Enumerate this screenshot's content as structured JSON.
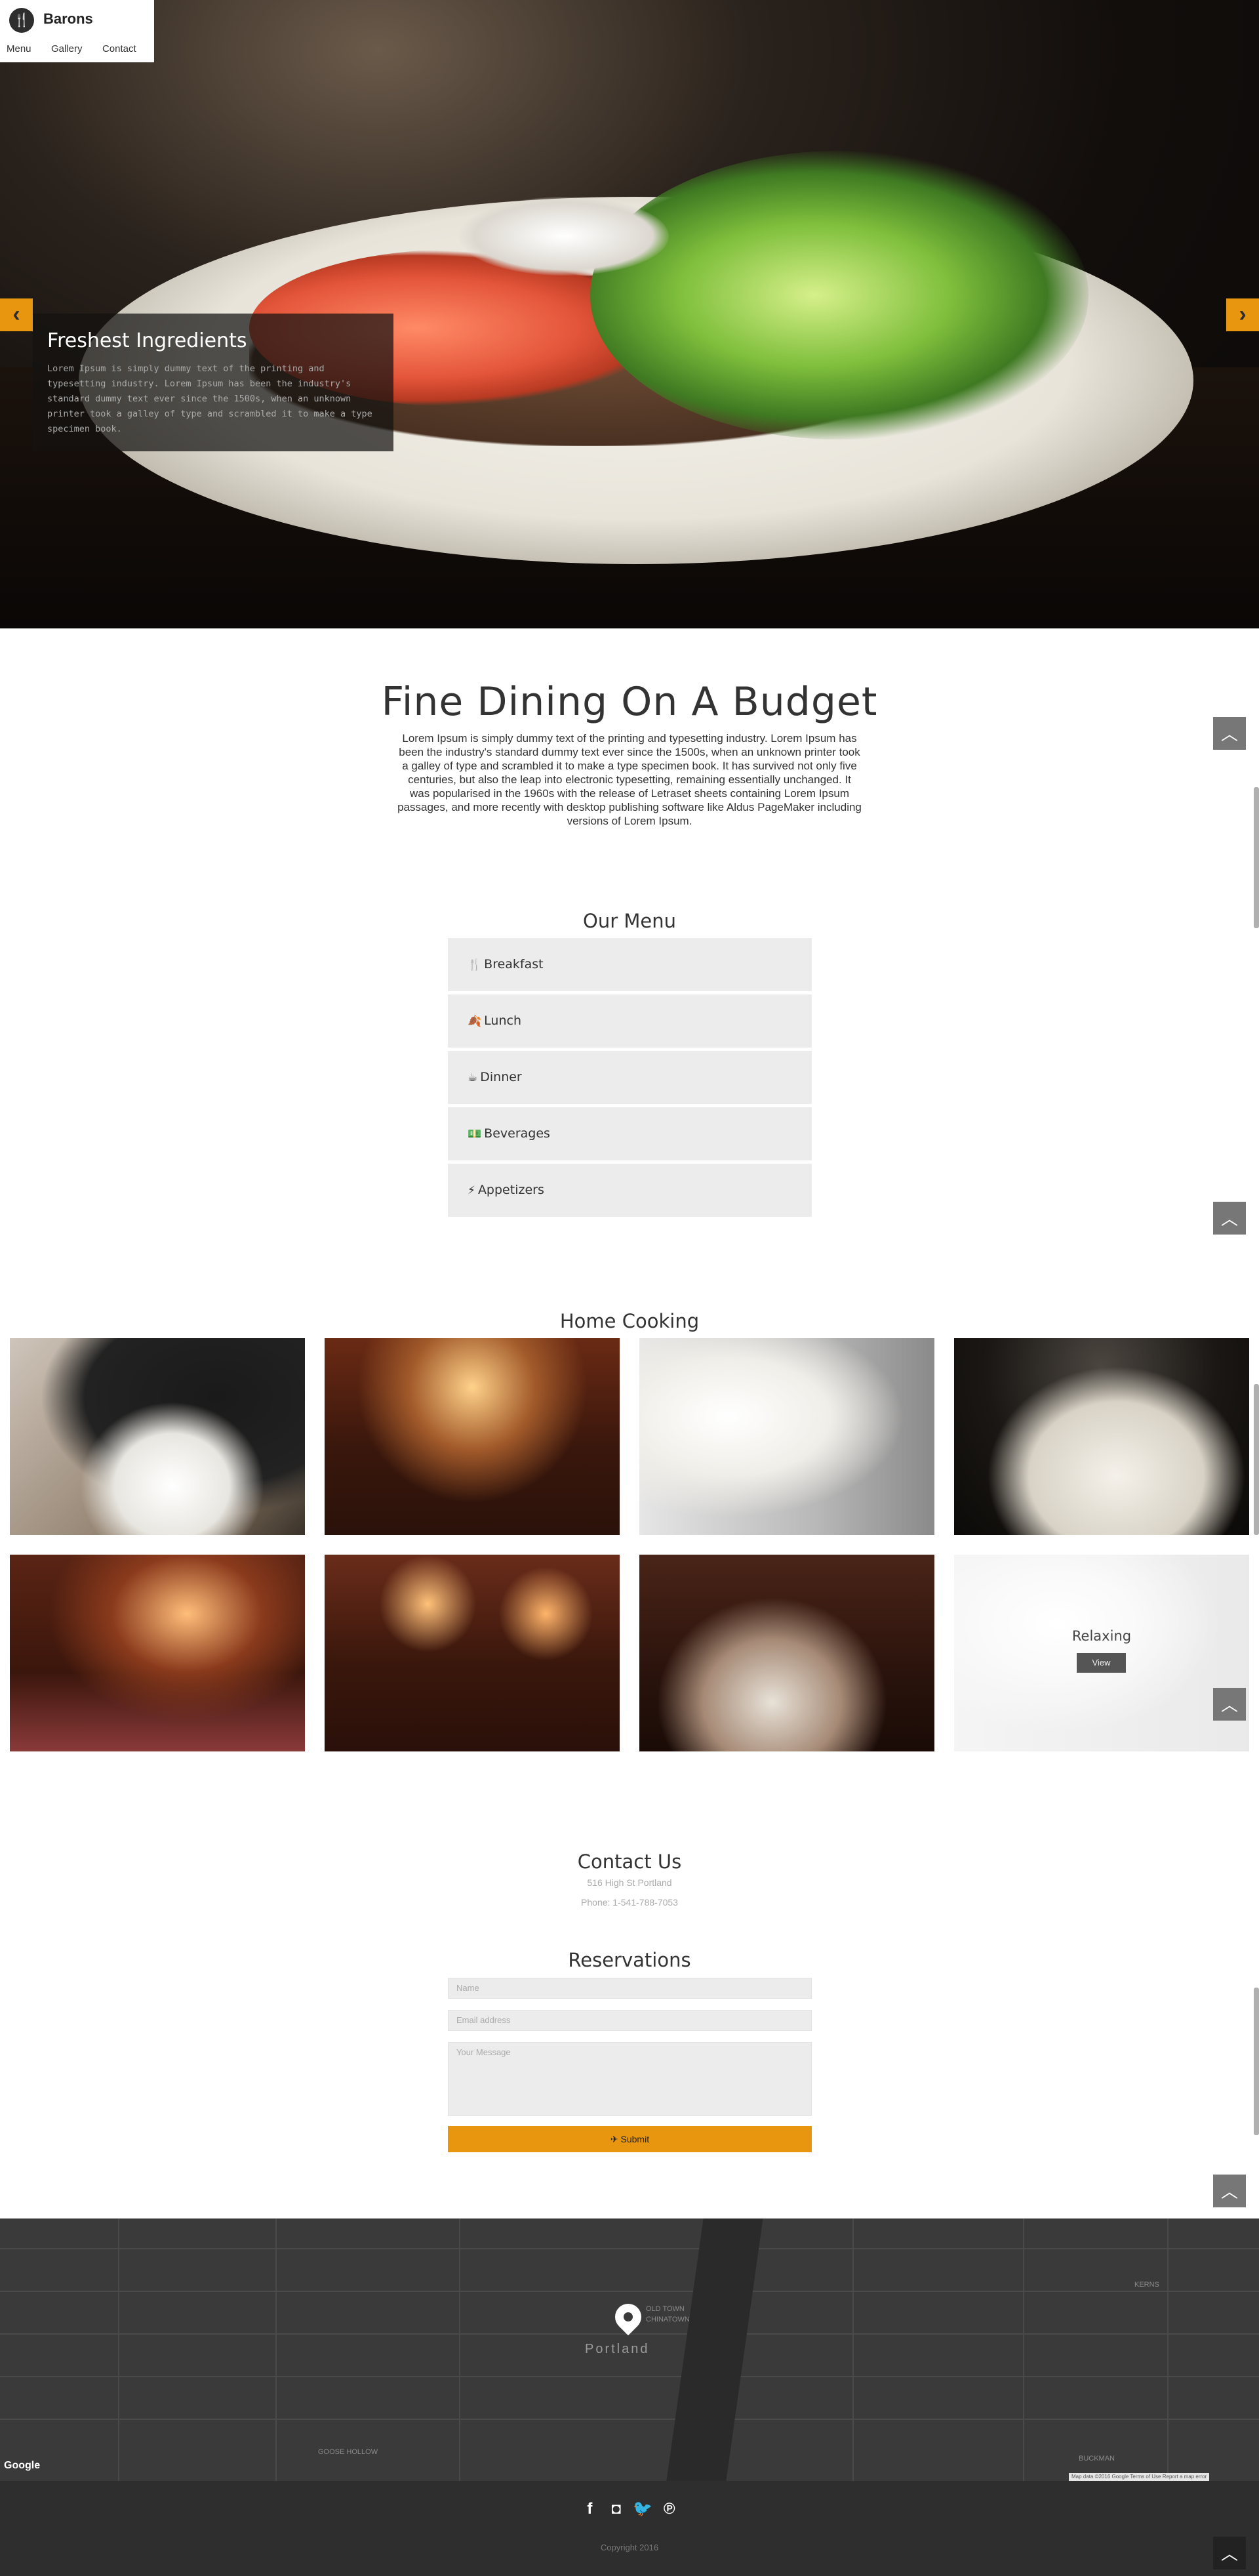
{
  "brand": {
    "name": "Barons",
    "logo_icon": "fork-knife-icon"
  },
  "nav": [
    "Menu",
    "Gallery",
    "Contact"
  ],
  "hero": {
    "caption_title": "Freshest Ingredients",
    "caption_text": "Lorem Ipsum is simply dummy text of the printing and typesetting industry. Lorem Ipsum has been the industry's standard dummy text ever since the 1500s, when an unknown printer took a galley of type and scrambled it to make a type specimen book.",
    "prev_icon": "chevron-left-icon",
    "next_icon": "chevron-right-icon",
    "accent_color": "#e8960f"
  },
  "intro": {
    "title": "Fine Dining On A Budget",
    "text": "Lorem Ipsum is simply dummy text of the printing and typesetting industry. Lorem Ipsum has been the industry's standard dummy text ever since the 1500s, when an unknown printer took a galley of type and scrambled it to make a type specimen book. It has survived not only five centuries, but also the leap into electronic typesetting, remaining essentially unchanged. It was popularised in the 1960s with the release of Letraset sheets containing Lorem Ipsum passages, and more recently with desktop publishing software like Aldus PageMaker including versions of Lorem Ipsum."
  },
  "menu": {
    "title": "Our Menu",
    "items": [
      {
        "label": "Breakfast",
        "icon": "cutlery-icon",
        "glyph": "🍴"
      },
      {
        "label": "Lunch",
        "icon": "leaf-icon",
        "glyph": "🍂"
      },
      {
        "label": "Dinner",
        "icon": "coffee-icon",
        "glyph": "☕"
      },
      {
        "label": "Beverages",
        "icon": "money-icon",
        "glyph": "💵"
      },
      {
        "label": "Appetizers",
        "icon": "bolt-icon",
        "glyph": "⚡"
      }
    ]
  },
  "gallery": {
    "title": "Home Cooking",
    "hover_title": "Relaxing",
    "hover_button": "View"
  },
  "contact": {
    "title": "Contact Us",
    "address": "516 High St Portland",
    "phone": "Phone: 1-541-788-7053"
  },
  "reservations": {
    "title": "Reservations",
    "name_placeholder": "Name",
    "email_placeholder": "Email address",
    "message_placeholder": "Your Message",
    "submit_label": "Submit",
    "submit_icon": "paper-plane-icon"
  },
  "map": {
    "city": "Portland",
    "provider": "Google",
    "terms": "Map data ©2016 Google  Terms of Use  Report a map error",
    "labels": [
      "GOOSE HOLLOW",
      "KERNS",
      "BUCKMAN",
      "OLD TOWN",
      "CHINATOWN"
    ]
  },
  "footer": {
    "social": [
      {
        "icon": "facebook-icon",
        "glyph": "f"
      },
      {
        "icon": "instagram-icon",
        "glyph": "◘"
      },
      {
        "icon": "twitter-icon",
        "glyph": "🐦"
      },
      {
        "icon": "pinterest-icon",
        "glyph": "℗"
      }
    ],
    "copyright": "Copyright 2016"
  },
  "back_to_top_icon": "chevron-up-icon"
}
